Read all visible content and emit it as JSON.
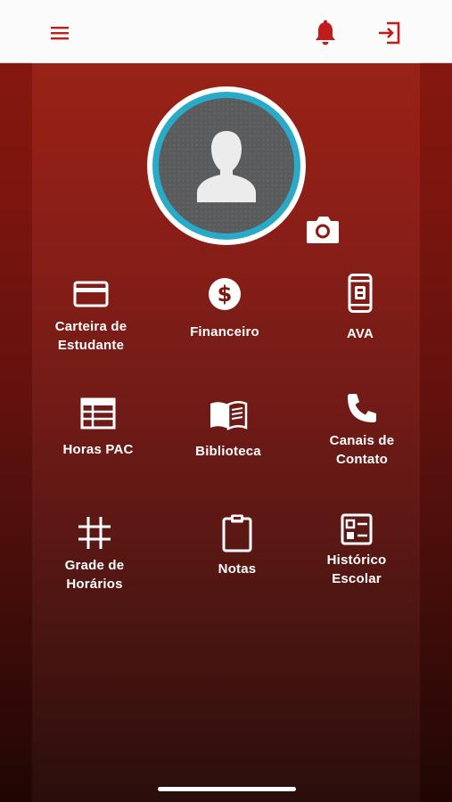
{
  "header": {
    "menu_icon": "hamburger-menu-icon",
    "bell_icon": "notification-bell-icon",
    "exit_icon": "logout-icon",
    "accent_color": "#c21b1b"
  },
  "profile": {
    "avatar_icon": "user-silhouette-icon",
    "camera_icon": "camera-icon",
    "ring_color": "#29aac8"
  },
  "menu": [
    {
      "label_1": "Carteira de",
      "label_2": "Estudante",
      "icon": "card-icon"
    },
    {
      "label_1": "Financeiro",
      "label_2": "",
      "icon": "dollar-icon"
    },
    {
      "label_1": "AVA",
      "label_2": "",
      "icon": "phone-app-icon"
    },
    {
      "label_1": "Horas PAC",
      "label_2": "",
      "icon": "calendar-table-icon"
    },
    {
      "label_1": "Biblioteca",
      "label_2": "",
      "icon": "book-icon"
    },
    {
      "label_1": "Canais de",
      "label_2": "Contato",
      "icon": "phone-icon"
    },
    {
      "label_1": "Grade de",
      "label_2": "Horários",
      "icon": "grid-hash-icon"
    },
    {
      "label_1": "Notas",
      "label_2": "",
      "icon": "clipboard-icon"
    },
    {
      "label_1": "Histórico",
      "label_2": "Escolar",
      "icon": "checklist-icon"
    }
  ]
}
